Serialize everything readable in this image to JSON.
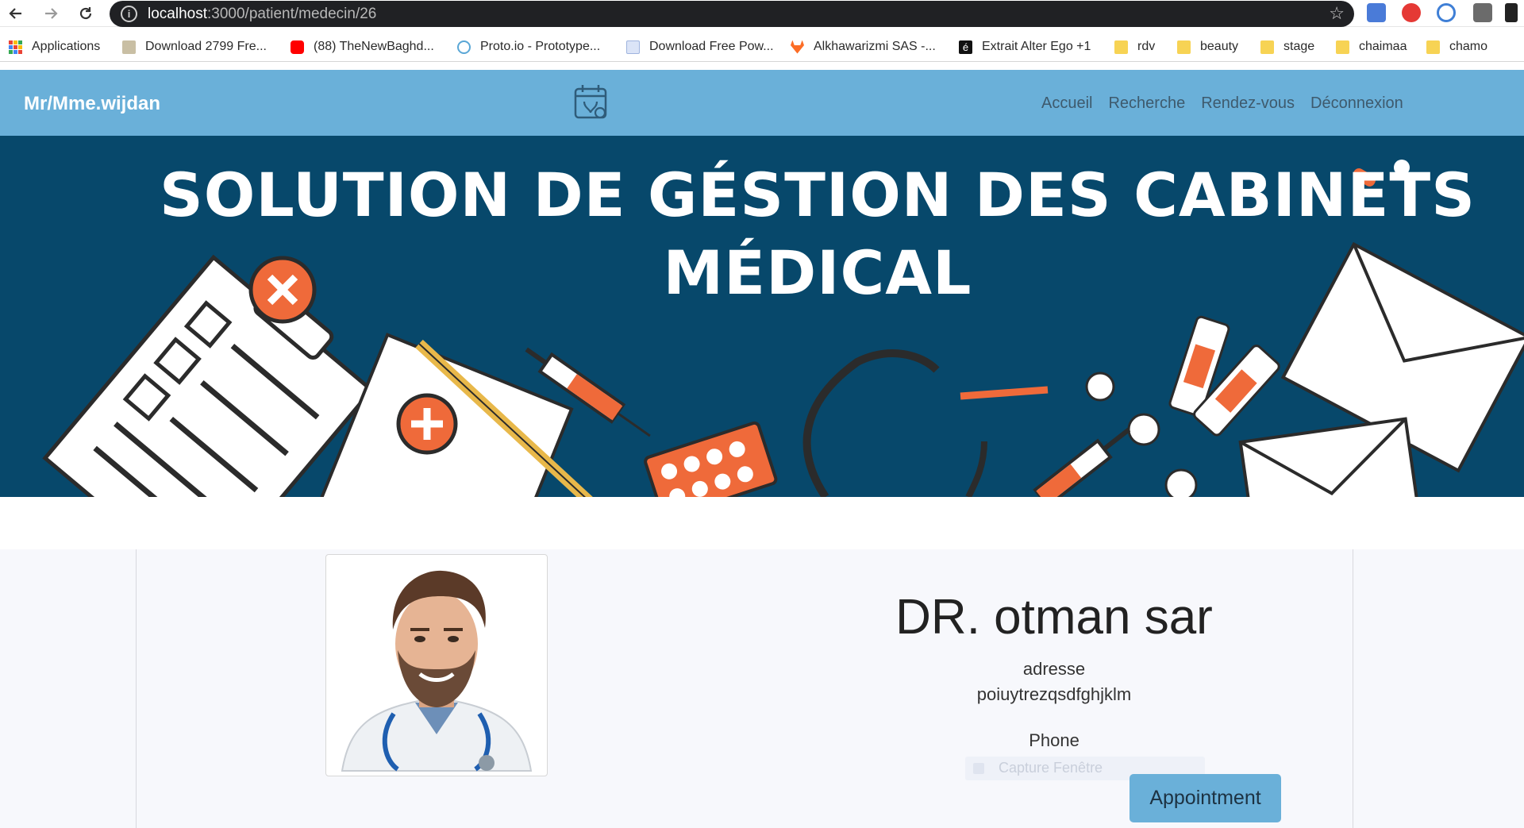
{
  "browser": {
    "url_host": "localhost",
    "url_path": ":3000/patient/medecin/26",
    "bookmarks": [
      {
        "label": "Applications",
        "icon": "apps-grid-icon"
      },
      {
        "label": "Download 2799 Fre...",
        "icon": "page-icon"
      },
      {
        "label": "(88) TheNewBaghd...",
        "icon": "youtube-icon"
      },
      {
        "label": "Proto.io - Prototype...",
        "icon": "protoio-icon"
      },
      {
        "label": "Download Free Pow...",
        "icon": "page-icon"
      },
      {
        "label": "Alkhawarizmi SAS -...",
        "icon": "gitlab-icon"
      },
      {
        "label": "Extrait Alter Ego +1",
        "icon": "e-icon"
      },
      {
        "label": "rdv",
        "icon": "folder-icon"
      },
      {
        "label": "beauty",
        "icon": "folder-icon"
      },
      {
        "label": "stage",
        "icon": "folder-icon"
      },
      {
        "label": "chaimaa",
        "icon": "folder-icon"
      },
      {
        "label": "chamo",
        "icon": "folder-icon"
      }
    ]
  },
  "navbar": {
    "brand": "Mr/Mme.wijdan",
    "links": [
      "Accueil",
      "Recherche",
      "Rendez-vous",
      "Déconnexion"
    ]
  },
  "hero": {
    "title_line1": "SOLUTION DE GÉSTION DES CABINETS",
    "title_line2": "MÉDICAL"
  },
  "doctor": {
    "name": "DR. otman sar",
    "address_label": "adresse",
    "address_value": "poiuytrezqsdfghjklm",
    "phone_label": "Phone",
    "overlay_text": "Capture Fenêtre",
    "appointment_button": "Appointment"
  },
  "colors": {
    "navbar": "#6ab0d9",
    "hero_bg": "#07486b",
    "accent_orange": "#ef6a3a"
  }
}
